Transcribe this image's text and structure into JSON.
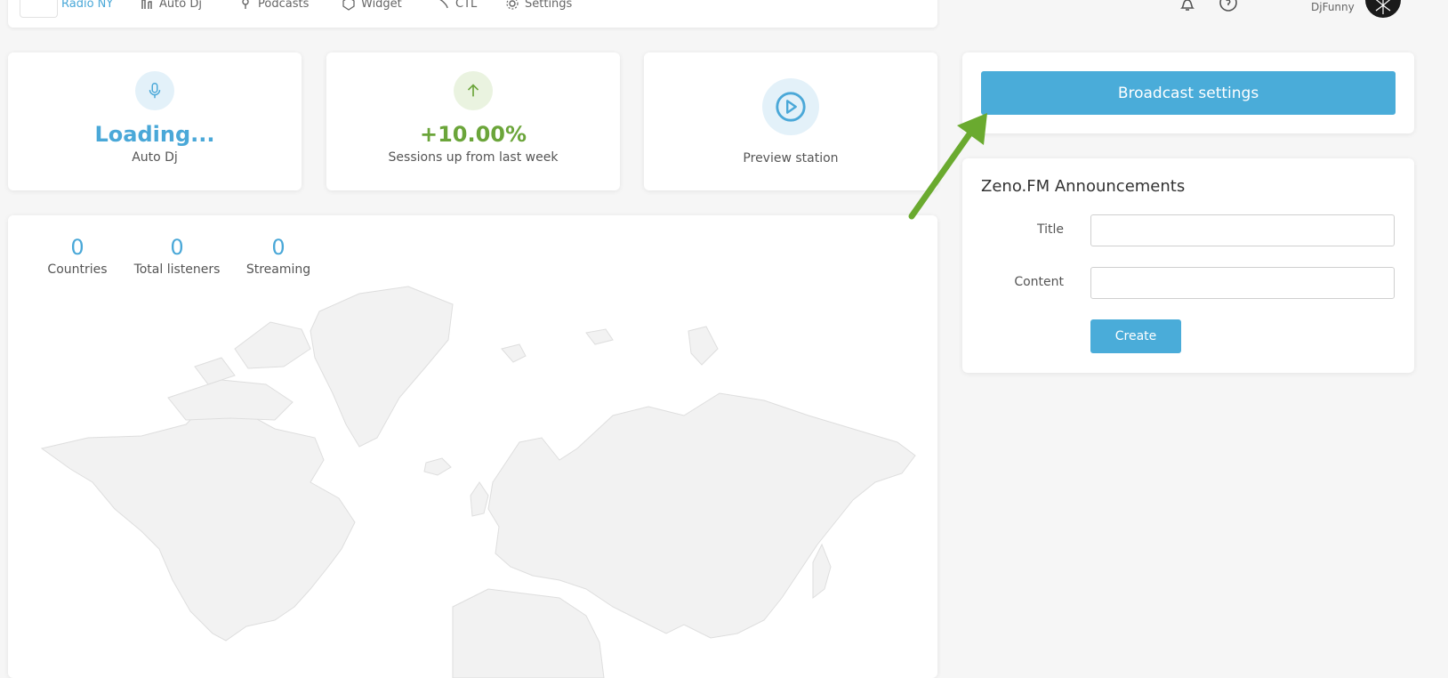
{
  "nav": {
    "station_name": "Radio NY",
    "items": [
      {
        "label": "Auto Dj",
        "icon": "autodj-icon"
      },
      {
        "label": "Podcasts",
        "icon": "podcast-icon"
      },
      {
        "label": "Widget",
        "icon": "widget-icon"
      },
      {
        "label": "CTL",
        "icon": "ctl-icon"
      },
      {
        "label": "Settings",
        "icon": "gear-icon"
      }
    ],
    "user_name": "DjFunny"
  },
  "stats": {
    "autodj": {
      "value": "Loading...",
      "label": "Auto Dj",
      "icon": "microphone-icon",
      "color": "#4aa8d8"
    },
    "sessions": {
      "value": "+10.00%",
      "label": "Sessions up from last week",
      "icon": "arrow-up-icon",
      "color": "#6ba53a"
    },
    "preview": {
      "label": "Preview station",
      "icon": "play-icon"
    }
  },
  "counters": [
    {
      "value": "0",
      "label": "Countries"
    },
    {
      "value": "0",
      "label": "Total listeners"
    },
    {
      "value": "0",
      "label": "Streaming"
    }
  ],
  "broadcast": {
    "button_label": "Broadcast settings"
  },
  "announcements": {
    "title": "Zeno.FM Announcements",
    "title_label": "Title",
    "content_label": "Content",
    "create_label": "Create"
  },
  "colors": {
    "accent": "#4aacd9",
    "arrow": "#6aaa2f",
    "positive": "#6ba53a"
  }
}
